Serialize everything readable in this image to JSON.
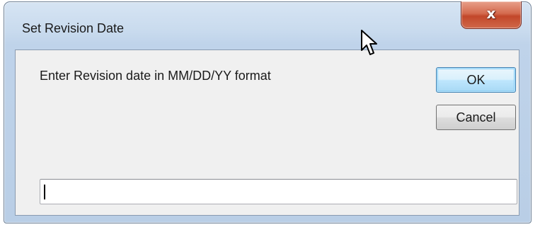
{
  "dialog": {
    "title": "Set Revision Date",
    "close_glyph": "x",
    "prompt": "Enter Revision date in MM/DD/YY format",
    "ok_label": "OK",
    "cancel_label": "Cancel",
    "input_value": ""
  },
  "colors": {
    "title_bar": "#c9dbee",
    "close_button": "#c2472a",
    "client_area": "#f0f0f0",
    "default_button_border": "#3c7fb1"
  },
  "icons": {
    "close": "close-icon",
    "mouse_cursor": "mouse-pointer-icon"
  }
}
